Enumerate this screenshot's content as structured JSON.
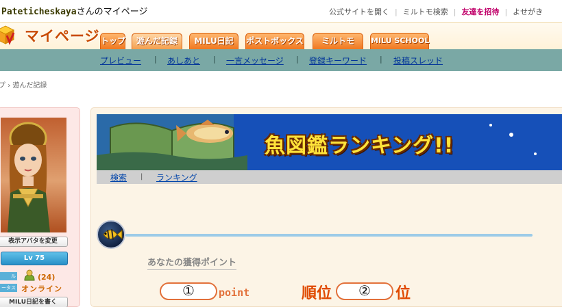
{
  "owner": {
    "username": "Pateticheskaya",
    "suffix": "さんのマイページ"
  },
  "toplinks": {
    "official": "公式サイトを開く",
    "search": "ミルトモ検索",
    "invite": "友達を招待",
    "more": "よせがき"
  },
  "header": {
    "logo_text": "マイページ"
  },
  "tabs": [
    "トップ",
    "遊んだ記録",
    "MILU日記",
    "ポストボックス",
    "ミルトモ",
    "MILU SCHOOL"
  ],
  "subnav": [
    "プレビュー",
    "あしあと",
    "一言メッセージ",
    "登録キーワード",
    "投稿スレッド"
  ],
  "breadcrumb": {
    "current": "遊んだ記録",
    "prev": "プ"
  },
  "sidebar": {
    "change_avatar": "表示アバタを変更",
    "level": "Lv 75",
    "label1": "ル",
    "label2": "ータス",
    "friend_count": "(24)",
    "status": "オンライン",
    "write_diary": "MILU日記を書く"
  },
  "banner": {
    "title": "魚図鑑ランキング!!"
  },
  "inner_nav": {
    "search": "検索",
    "sep": "|",
    "ranking": "ランキング"
  },
  "points": {
    "heading": "あなたの獲得ポイント",
    "points_value": "①",
    "points_unit": "point",
    "rank_label": "順位",
    "rank_value": "②",
    "rank_unit": "位"
  },
  "colors": {
    "accent_orange": "#f07820",
    "nav_teal": "#7aa8a5",
    "banner_blue": "#1650b8"
  }
}
